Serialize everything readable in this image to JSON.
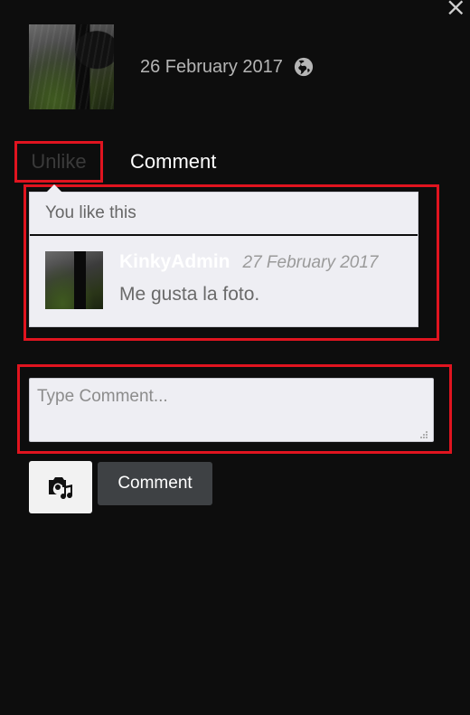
{
  "modal": {
    "close_symbol": "×"
  },
  "post": {
    "date": "26 February 2017",
    "visibility_icon": "globe-icon"
  },
  "actions": {
    "unlike_label": "Unlike",
    "comment_label": "Comment"
  },
  "likes": {
    "summary": "You like this"
  },
  "comments": [
    {
      "author": "KinkyAdmin",
      "date": "27 February 2017",
      "text": "Me gusta la foto."
    }
  ],
  "composer": {
    "placeholder": "Type Comment...",
    "media_icon": "camera-music-icon",
    "submit_label": "Comment"
  },
  "colors": {
    "highlight": "#e0141f",
    "background": "#0d0d0d",
    "panel": "#eeeef3",
    "button": "#3e4144"
  }
}
